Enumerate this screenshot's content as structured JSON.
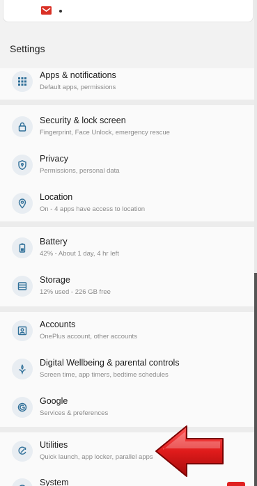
{
  "page_title": "Settings",
  "items": [
    {
      "title": "Apps & notifications",
      "subtitle": "Default apps, permissions",
      "icon": "apps-grid-icon"
    },
    {
      "title": "Security & lock screen",
      "subtitle": "Fingerprint, Face Unlock, emergency rescue",
      "icon": "lock-icon"
    },
    {
      "title": "Privacy",
      "subtitle": "Permissions, personal data",
      "icon": "shield-icon"
    },
    {
      "title": "Location",
      "subtitle": "On - 4 apps have access to location",
      "icon": "location-pin-icon"
    },
    {
      "title": "Battery",
      "subtitle": "42% - About 1 day, 4 hr left",
      "icon": "battery-icon"
    },
    {
      "title": "Storage",
      "subtitle": "12% used - 226 GB free",
      "icon": "storage-icon"
    },
    {
      "title": "Accounts",
      "subtitle": "OnePlus account, other accounts",
      "icon": "account-icon"
    },
    {
      "title": "Digital Wellbeing & parental controls",
      "subtitle": "Screen time, app timers, bedtime schedules",
      "icon": "wellbeing-icon"
    },
    {
      "title": "Google",
      "subtitle": "Services & preferences",
      "icon": "google-icon"
    },
    {
      "title": "Utilities",
      "subtitle": "Quick launch, app locker, parallel apps",
      "icon": "utilities-icon"
    },
    {
      "title": "System",
      "subtitle": "",
      "icon": "system-icon"
    }
  ],
  "colors": {
    "background": "#f2f2f2",
    "card": "#fafafa",
    "icon_circle": "#e8edf2",
    "icon_stroke": "#2f6f98",
    "arrow": "#e01b1b"
  }
}
